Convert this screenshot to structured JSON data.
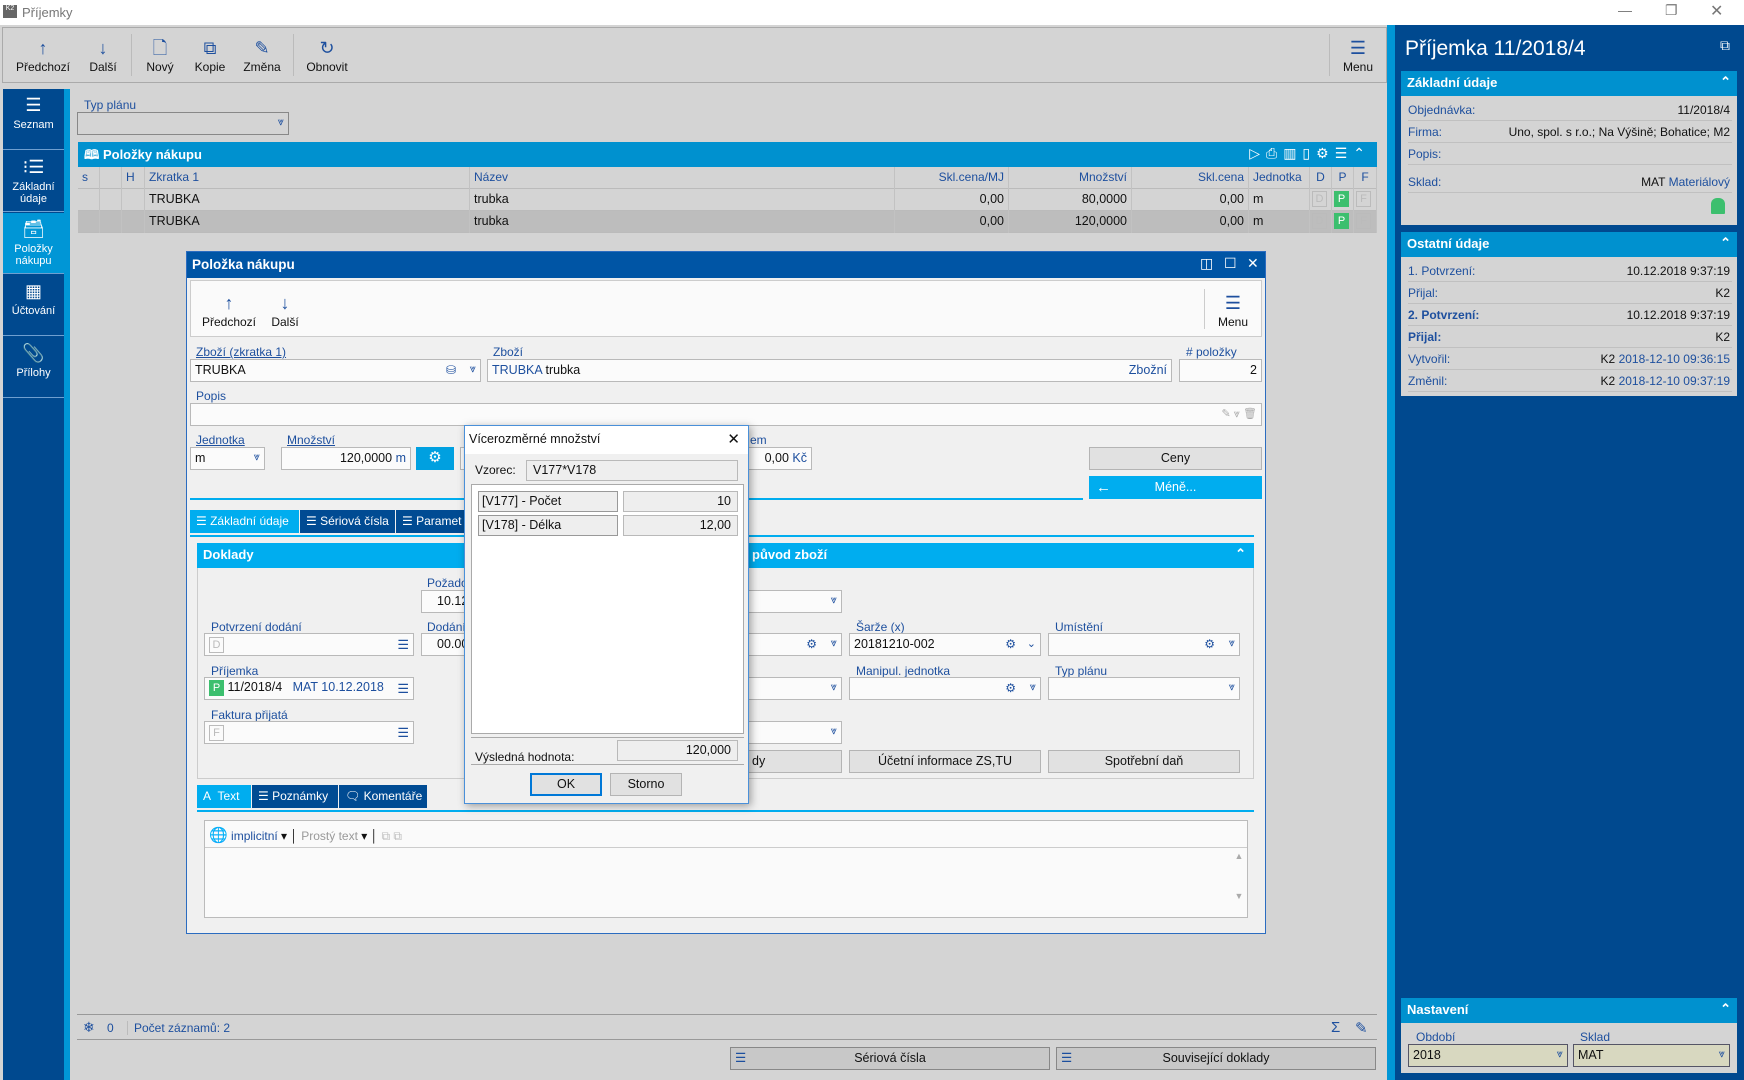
{
  "window": {
    "title": "Příjemky"
  },
  "toolbar": {
    "items": [
      {
        "label": "Předchozí",
        "icon": "arrow-up-icon"
      },
      {
        "label": "Další",
        "icon": "arrow-down-icon"
      },
      {
        "label": "Nový",
        "icon": "new-document-icon"
      },
      {
        "label": "Kopie",
        "icon": "copy-icon"
      },
      {
        "label": "Změna",
        "icon": "pencil-icon"
      },
      {
        "label": "Obnovit",
        "icon": "refresh-icon"
      }
    ],
    "menu": "Menu"
  },
  "nav": [
    {
      "label": "Seznam"
    },
    {
      "label": "Základní údaje"
    },
    {
      "label": "Položky nákupu",
      "selected": true
    },
    {
      "label": "Účtování"
    },
    {
      "label": "Přílohy"
    }
  ],
  "filter": {
    "label": "Typ plánu",
    "value": ""
  },
  "grid": {
    "title": "Položky nákupu",
    "columns": [
      "s",
      "",
      "H",
      "Zkratka 1",
      "Název",
      "Skl.cena/MJ",
      "Množství",
      "Skl.cena",
      "Jednotka",
      "D",
      "P",
      "F"
    ],
    "rows": [
      [
        "",
        "",
        "",
        "TRUBKA",
        "trubka",
        "0,00",
        "80,0000",
        "0,00",
        "m",
        "D",
        "P",
        "F"
      ],
      [
        "",
        "",
        "",
        "TRUBKA",
        "trubka",
        "0,00",
        "120,0000",
        "0,00",
        "m",
        "D",
        "P",
        "F"
      ]
    ]
  },
  "status": {
    "filter_count": "0",
    "records": "Počet záznamů: 2"
  },
  "bottom_buttons": {
    "serial": "Sériová čísla",
    "related": "Související doklady"
  },
  "right": {
    "title": "Příjemka 11/2018/4",
    "basic": {
      "header": "Základní údaje",
      "rows": [
        {
          "label": "Objednávka:",
          "value": "11/2018/4"
        },
        {
          "label": "Firma:",
          "value": "Uno, spol. s r.o.; Na Výšině; Bohatice; M2"
        },
        {
          "label": "Popis:",
          "value": ""
        },
        {
          "label": "Sklad:",
          "value": "MAT",
          "value2": "Materiálový"
        }
      ]
    },
    "other": {
      "header": "Ostatní údaje",
      "rows": [
        {
          "label": "1. Potvrzení:",
          "value": "10.12.2018 9:37:19"
        },
        {
          "label": "Přijal:",
          "value": "K2"
        },
        {
          "label": "2. Potvrzení:",
          "value": "10.12.2018 9:37:19"
        },
        {
          "label": "Přijal:",
          "value": "K2"
        },
        {
          "label": "Vytvořil:",
          "value": "K2",
          "value2": "2018-12-10 09:36:15"
        },
        {
          "label": "Změnil:",
          "value": "K2",
          "value2": "2018-12-10 09:37:19"
        }
      ]
    },
    "settings": {
      "header": "Nastavení",
      "period_label": "Období",
      "period": "2018",
      "store_label": "Sklad",
      "store": "MAT"
    }
  },
  "item_form": {
    "title": "Položka nákupu",
    "prev": "Předchozí",
    "next": "Další",
    "menu": "Menu",
    "goods_short_label": "Zboží (zkratka 1)",
    "goods_short": "TRUBKA",
    "goods_label": "Zboží",
    "goods_code": "TRUBKA",
    "goods_name": "trubka",
    "goods_type": "Zbožní",
    "item_no_label": "# položky",
    "item_no": "2",
    "desc_label": "Popis",
    "desc": "",
    "unit_label": "Jednotka",
    "unit": "m",
    "qty_label": "Množství",
    "qty": "120,0000",
    "qty_unit": "m",
    "price_label_fragment": "em",
    "price": "0,00",
    "currency": "Kč",
    "prices_btn": "Ceny",
    "less_btn": "Méně...",
    "tabs": [
      "Základní údaje",
      "Sériová čísla",
      "Paramet"
    ],
    "docs": {
      "header": "Doklady",
      "requested_label": "Požado",
      "requested": "10.12",
      "delivery_confirm_label": "Potvrzení dodání",
      "delivery_label": "Dodání",
      "delivery": "00.00",
      "receipt_label": "Příjemka",
      "receipt_badge": "P",
      "receipt_no": "11/2018/4",
      "receipt_info": "MAT 10.12.2018",
      "invoice_label": "Faktura přijatá",
      "badge_d": "D",
      "badge_f": "F"
    },
    "origin": {
      "header_fragment": "původ zboží",
      "batch_label": "Šarže (x)",
      "batch": "20181210-002",
      "location_label": "Umístění",
      "handling_unit_label": "Manipul. jednotka",
      "plan_type_label": "Typ plánu",
      "btn_fragment": "dy",
      "btn_accounting": "Účetní informace ZS,TU",
      "btn_excise": "Spotřební daň"
    },
    "text_tabs": [
      "Text",
      "Poznámky",
      "Komentáře"
    ],
    "editor": {
      "language": "implicitní",
      "format": "Prostý text"
    }
  },
  "dialog": {
    "title": "Vícerozměrné množství",
    "formula_label": "Vzorec:",
    "formula": "V177*V178",
    "vars": [
      {
        "label": "[V177] - Počet",
        "value": "10"
      },
      {
        "label": "[V178] - Délka",
        "value": "12,00"
      }
    ],
    "result_label": "Výsledná hodnota:",
    "result": "120,000",
    "ok": "OK",
    "cancel": "Storno"
  },
  "colors": {
    "dark_blue": "#004b93",
    "header_blue": "#0091cf",
    "accent_blue": "#00adef",
    "green": "#3cbf6e"
  }
}
